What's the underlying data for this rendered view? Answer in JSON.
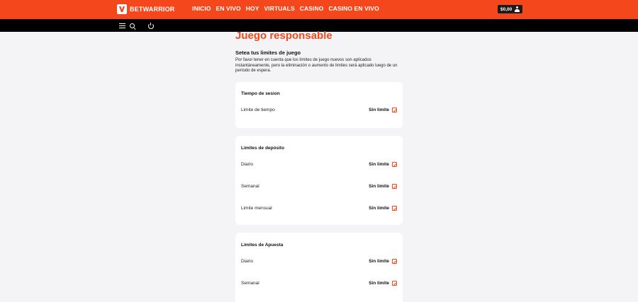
{
  "brand": {
    "name": "BETWARRIOR",
    "accent": "#f4471c"
  },
  "nav": [
    "INICIO",
    "EN VIVO",
    "HOY",
    "VIRTUALS",
    "CASINO",
    "CASINO EN VIVO"
  ],
  "account": {
    "balance": "$0,00"
  },
  "icons": [
    "menu-icon",
    "search-icon",
    "power-icon",
    "user-icon",
    "edit-icon"
  ],
  "page": {
    "title": "Juego responsable",
    "section_title": "Setea tus limites de juego",
    "intro": "Por favor tener en cuenta que los límites de juego nuevos son aplicados instantáneamente, pero la eliminación o aumento de limites será aplicado luego de un período de espera."
  },
  "cards": [
    {
      "title": "Tiempo de sesion",
      "rows": [
        {
          "label": "Limite de tiempo",
          "value": "Sin limite"
        }
      ]
    },
    {
      "title": "Limites de depósito",
      "rows": [
        {
          "label": "Diario",
          "value": "Sin limite"
        },
        {
          "label": "Semanal",
          "value": "Sin limite"
        },
        {
          "label": "Limite mensual",
          "value": "Sin limite"
        }
      ]
    },
    {
      "title": "Limites de Apuesta",
      "rows": [
        {
          "label": "Diario",
          "value": "Sin limite"
        },
        {
          "label": "Semanal",
          "value": "Sin limite"
        }
      ]
    }
  ]
}
